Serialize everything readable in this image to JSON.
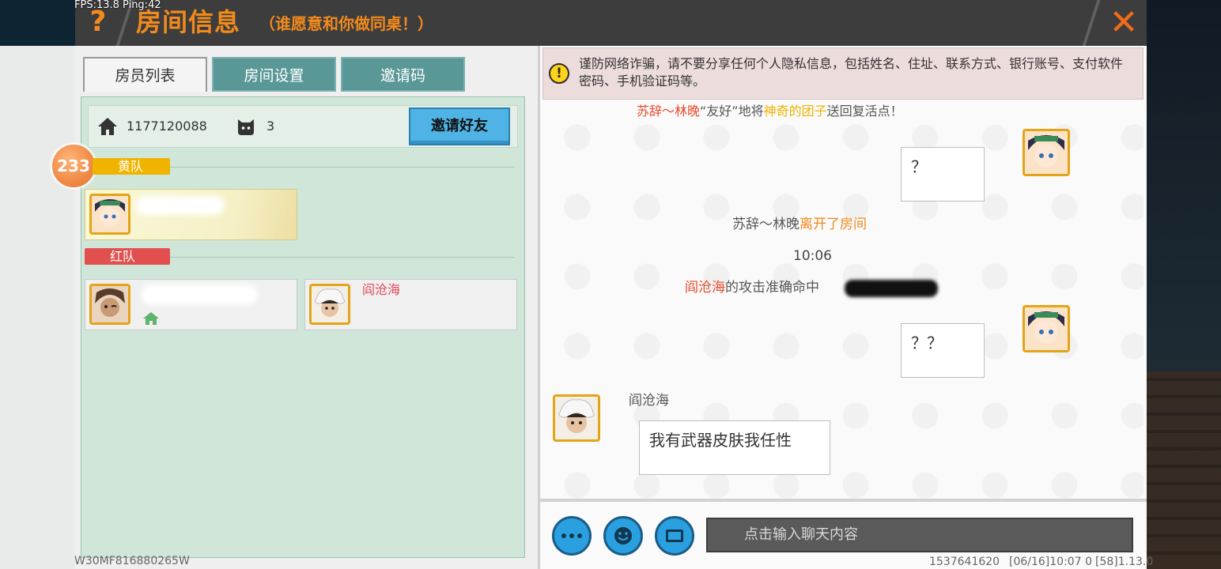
{
  "overlay": {
    "fps": "FPS:13.8  Ping:42"
  },
  "header": {
    "title": "房间信息",
    "subtitle": "（谁愿意和你做同桌！）",
    "help_glyph": "?",
    "close_glyph": "✕"
  },
  "tabs": [
    {
      "label": "房员列表",
      "active": true
    },
    {
      "label": "房间设置",
      "active": false
    },
    {
      "label": "邀请码",
      "active": false
    }
  ],
  "room": {
    "id": "1177120088",
    "player_count": "3",
    "invite_button": "邀请好友"
  },
  "level_badge": "233",
  "teams": {
    "yellow": {
      "label": "黄队"
    },
    "red": {
      "label": "红队"
    }
  },
  "members": {
    "red_member_2_name": "阎沧海"
  },
  "warning": "谨防网络诈骗，请不要分享任何个人隐私信息，包括姓名、住址、联系方式、银行账号、支付软件密码、手机验证码等。",
  "chat": {
    "msg1": {
      "a": "苏辞～林晚",
      "b": "“友好”地将",
      "c": "神奇的团子",
      "d": "送回复活点！"
    },
    "bubble1": "？",
    "msg2": {
      "a": "苏辞～林晚",
      "b": "离开了房间"
    },
    "time": "10:06",
    "msg3": {
      "a": "阎沧海",
      "b": "的攻击准确命中"
    },
    "bubble2": "？？",
    "sender3": "阎沧海",
    "bubble3": "我有武器皮肤我任性",
    "input_placeholder": "点击输入聊天内容"
  },
  "footer": {
    "device_id": "W30MF816880265W",
    "uid": "1537641620",
    "date": "[06/16]10:07 0",
    "version": "[58]1.13.0"
  },
  "colors": {
    "accent": "#f28a1c",
    "header_bg": "#3d3d3d",
    "tab_inactive": "#5a9797",
    "member_bg": "#cfe6d9",
    "button_blue": "#4fb3e6"
  }
}
